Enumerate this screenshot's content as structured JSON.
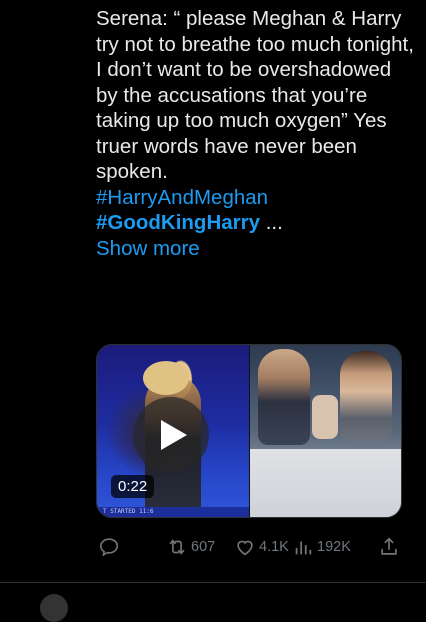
{
  "tweet": {
    "text_lines": "Serena: “ please Meghan & Harry try not to breathe too much tonight, I don’t want to be overshadowed by the accusations that you’re taking up too much oxygen” Yes truer words have never been spoken.",
    "hashtag_1": "#HarryAndMeghan",
    "hashtag_2": "#GoodKingHarry",
    "ellipsis": "...",
    "show_more": "Show more"
  },
  "media": {
    "video_duration": "0:22",
    "overlay_text": "T STARTED  11:6"
  },
  "actions": {
    "reply_icon": "reply-icon",
    "retweet_icon": "retweet-icon",
    "retweet_count": "607",
    "like_icon": "heart-icon",
    "like_count": "4.1K",
    "views_icon": "views-icon",
    "views_count": "192K",
    "share_icon": "share-icon"
  },
  "colors": {
    "background": "#000000",
    "text": "#e7e9ea",
    "link": "#1d9bf0",
    "muted": "#71767b"
  }
}
